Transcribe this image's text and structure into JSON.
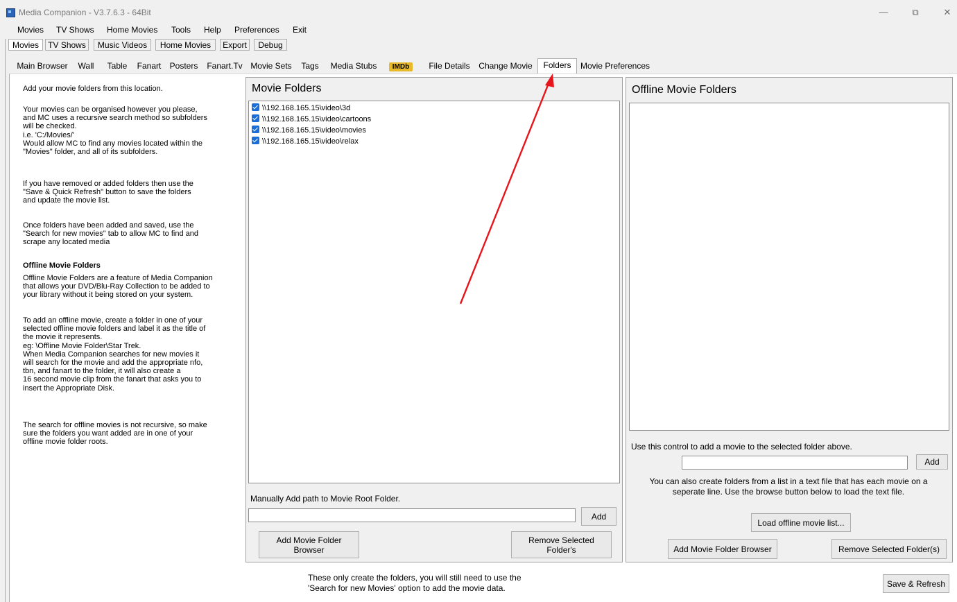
{
  "window": {
    "title": "Media Companion - V3.7.6.3 - 64Bit",
    "minimize_glyph": "—",
    "restore_glyph": "⧉",
    "close_glyph": "✕"
  },
  "menu": [
    "Movies",
    "TV Shows",
    "Home Movies",
    "Tools",
    "Help",
    "Preferences",
    "Exit"
  ],
  "toolbar": [
    "Movies",
    "TV Shows",
    "Music Videos",
    "Home Movies",
    "Export",
    "Debug"
  ],
  "tabs": [
    "Main Browser",
    "Wall",
    "Table",
    "Fanart",
    "Posters",
    "Fanart.Tv",
    "Movie Sets",
    "Tags",
    "Media Stubs",
    "IMDb",
    "File Details",
    "Change Movie",
    "Folders",
    "Movie Preferences"
  ],
  "selected_tab": "Folders",
  "help": {
    "p1": "Add your movie folders from this location.",
    "p2": "Your movies can be organised however you please,\nand MC uses a recursive search method so subfolders\nwill be checked.\ni.e. 'C:/Movies/'\nWould allow MC to find any movies located within the\n\"Movies\" folder, and all of its subfolders.",
    "p3": "If you have removed or added folders then use the\n\"Save & Quick Refresh\" button to save the folders\nand update the movie list.",
    "p4": "Once folders have been added and saved, use the\n\"Search for new movies\" tab to allow MC to find and\nscrape any located media",
    "offline_heading": "Offline Movie Folders",
    "p5": "Offline Movie Folders are a feature of Media Companion\nthat allows your DVD/Blu-Ray Collection to be added to\nyour library without it being stored on your system.",
    "p6": "To add an offline movie, create a folder in one of your\nselected offline movie folders and label it as the title of\nthe movie it represents.\neg: \\Offline Movie Folder\\Star Trek.\nWhen Media Companion searches for new movies it\nwill search for the movie and add the appropriate nfo,\ntbn, and fanart to the folder, it will also create a\n16 second movie clip from the fanart that asks you to\ninsert the Appropriate Disk.",
    "p7": "The search for offline movies is not recursive, so make\nsure the folders you want added are in one of your\noffline movie folder roots."
  },
  "movie_folders": {
    "title": "Movie Folders",
    "items": [
      {
        "path": "\\\\192.168.165.15\\video\\3d",
        "checked": true
      },
      {
        "path": "\\\\192.168.165.15\\video\\cartoons",
        "checked": true
      },
      {
        "path": "\\\\192.168.165.15\\video\\movies",
        "checked": true
      },
      {
        "path": "\\\\192.168.165.15\\video\\relax",
        "checked": true
      }
    ],
    "manual_label": "Manually Add path to Movie Root Folder.",
    "manual_value": "",
    "add_label": "Add",
    "browser_label": "Add Movie Folder\nBrowser",
    "remove_label": "Remove Selected\nFolder's"
  },
  "offline_folders": {
    "title": "Offline Movie Folders",
    "control_label": "Use this control to add a movie to the selected folder above.",
    "add_value": "",
    "add_label": "Add",
    "text_file_note": "You can also create folders from a list in a text file that has each movie on a\nseperate line. Use the browse button below to load the text file.",
    "load_label": "Load offline movie list...",
    "browser_label": "Add Movie Folder Browser",
    "remove_label": "Remove Selected Folder(s)"
  },
  "footer": {
    "note": "These only create the folders, you will still need to use the\n'Search for new Movies' option to add the movie data.",
    "save_label": "Save & Refresh"
  },
  "colors": {
    "checkbox": "#1a6ed8",
    "annotation_arrow": "#e8141b",
    "imdb_badge": "#e7b928"
  }
}
